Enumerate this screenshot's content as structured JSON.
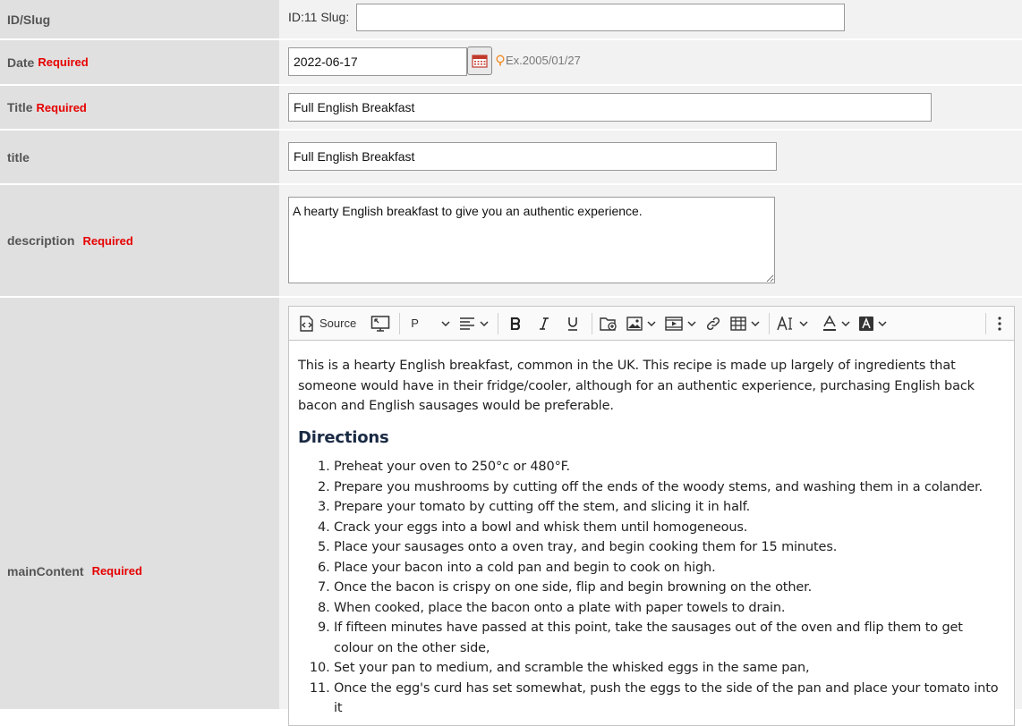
{
  "form": {
    "slug": {
      "label": "ID/Slug",
      "id_text": "ID:11 Slug:",
      "value": ""
    },
    "date": {
      "label": "Date",
      "required": "Required",
      "value": "2022-06-17",
      "hint": "Ex.2005/01/27"
    },
    "title_main": {
      "label": "Title",
      "required": "Required",
      "value": "Full English Breakfast"
    },
    "title_alt": {
      "label": "title",
      "value": "Full English Breakfast"
    },
    "description": {
      "label": "description",
      "required": "Required",
      "value": "A hearty English breakfast to give you an authentic experience."
    },
    "main_content": {
      "label": "mainContent",
      "required": "Required"
    }
  },
  "toolbar": {
    "source_label": "Source",
    "paragraph_label": "P",
    "icons": [
      "source-icon",
      "fullscreen-icon",
      "align-icon",
      "bold-icon",
      "italic-icon",
      "underline-icon",
      "insert-file-icon",
      "image-icon",
      "media-icon",
      "link-icon",
      "table-icon",
      "font-size-icon",
      "font-color-icon",
      "highlight-icon",
      "more-icon"
    ]
  },
  "content": {
    "intro": "This is a hearty English breakfast, common in the UK. This recipe is made up largely of ingredients that someone would have in their fridge/cooler, although for an authentic experience, purchasing English back bacon and English sausages would be preferable.",
    "heading": "Directions",
    "steps": [
      "Preheat your oven to 250°c or 480°F.",
      "Prepare you mushrooms by cutting off the ends of the woody stems, and washing them in a colander.",
      "Prepare your tomato by cutting off the stem, and slicing it in half.",
      "Crack your eggs into a bowl and whisk them until homogeneous.",
      "Place your sausages onto a oven tray, and begin cooking them for 15 minutes.",
      "Place your bacon into a cold pan and begin to cook on high.",
      "Once the bacon is crispy on one side, flip and begin browning on the other.",
      "When cooked, place the bacon onto a plate with paper towels to drain.",
      "If fifteen minutes have passed at this point, take the sausages out of the oven and flip them to get colour on the other side,",
      "Set your pan to medium, and scramble the whisked eggs in the same pan,",
      "Once the egg's curd has set somewhat, push the eggs to the side of the pan and place your tomato into it"
    ]
  },
  "colors": {
    "required": "#e60000",
    "label_bg": "#e0e0e0",
    "value_bg": "#f2f2f2",
    "hint_icon": "#f08a24",
    "calendar": "#c0392b"
  }
}
